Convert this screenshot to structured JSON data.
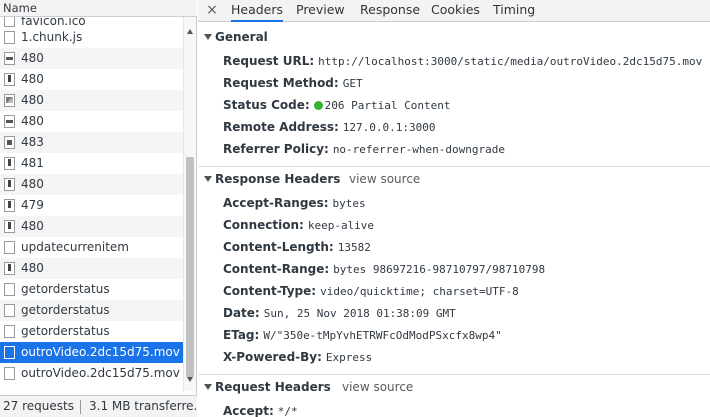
{
  "left_pane": {
    "header": "Name",
    "rows": [
      {
        "label": "favicon.ico",
        "icon": "generic-file-icon",
        "partial": true
      },
      {
        "label": "1.chunk.js",
        "icon": "script-file-icon"
      },
      {
        "label": "480",
        "icon": "video-file-icon"
      },
      {
        "label": "480",
        "icon": "exclamation-file-icon"
      },
      {
        "label": "480",
        "icon": "image-file-icon"
      },
      {
        "label": "480",
        "icon": "video-file-icon"
      },
      {
        "label": "483",
        "icon": "dark-file-icon"
      },
      {
        "label": "481",
        "icon": "exclamation-file-icon"
      },
      {
        "label": "480",
        "icon": "exclamation-file-icon"
      },
      {
        "label": "479",
        "icon": "exclamation-file-icon"
      },
      {
        "label": "480",
        "icon": "exclamation-file-icon"
      },
      {
        "label": "updatecurrenitem",
        "icon": "generic-file-icon"
      },
      {
        "label": "480",
        "icon": "exclamation-file-icon"
      },
      {
        "label": "getorderstatus",
        "icon": "generic-file-icon"
      },
      {
        "label": "getorderstatus",
        "icon": "generic-file-icon"
      },
      {
        "label": "getorderstatus",
        "icon": "generic-file-icon"
      },
      {
        "label": "outroVideo.2dc15d75.mov",
        "icon": "generic-file-icon",
        "selected": true
      },
      {
        "label": "outroVideo.2dc15d75.mov",
        "icon": "generic-file-icon"
      }
    ],
    "status": {
      "requests": "27 requests",
      "transferred": "3.1 MB transferre..."
    }
  },
  "tabs": [
    {
      "label": "Headers",
      "active": true
    },
    {
      "label": "Preview"
    },
    {
      "label": "Response"
    },
    {
      "label": "Cookies"
    },
    {
      "label": "Timing"
    }
  ],
  "close_icon": "×",
  "general": {
    "title": "General",
    "items": [
      {
        "key": "Request URL:",
        "value": "http://localhost:3000/static/media/outroVideo.2dc15d75.mov"
      },
      {
        "key": "Request Method:",
        "value": "GET"
      },
      {
        "key": "Status Code:",
        "value": "206 Partial Content",
        "status_color": "#2fb52f"
      },
      {
        "key": "Remote Address:",
        "value": "127.0.0.1:3000"
      },
      {
        "key": "Referrer Policy:",
        "value": "no-referrer-when-downgrade"
      }
    ]
  },
  "response_headers": {
    "title": "Response Headers",
    "view_source": "view source",
    "items": [
      {
        "key": "Accept-Ranges:",
        "value": "bytes"
      },
      {
        "key": "Connection:",
        "value": "keep-alive"
      },
      {
        "key": "Content-Length:",
        "value": "13582"
      },
      {
        "key": "Content-Range:",
        "value": "bytes 98697216-98710797/98710798"
      },
      {
        "key": "Content-Type:",
        "value": "video/quicktime; charset=UTF-8"
      },
      {
        "key": "Date:",
        "value": "Sun, 25 Nov 2018 01:38:09 GMT"
      },
      {
        "key": "ETag:",
        "value": "W/\"350e-tMpYvhETRWFcOdModPSxcfx8wp4\""
      },
      {
        "key": "X-Powered-By:",
        "value": "Express"
      }
    ]
  },
  "request_headers": {
    "title": "Request Headers",
    "view_source": "view source",
    "items": [
      {
        "key": "Accept:",
        "value": "*/*"
      }
    ]
  },
  "colors": {
    "selected_row": "#1a73e8",
    "active_tab_underline": "#1a73e8",
    "status_ok": "#2fb52f"
  }
}
